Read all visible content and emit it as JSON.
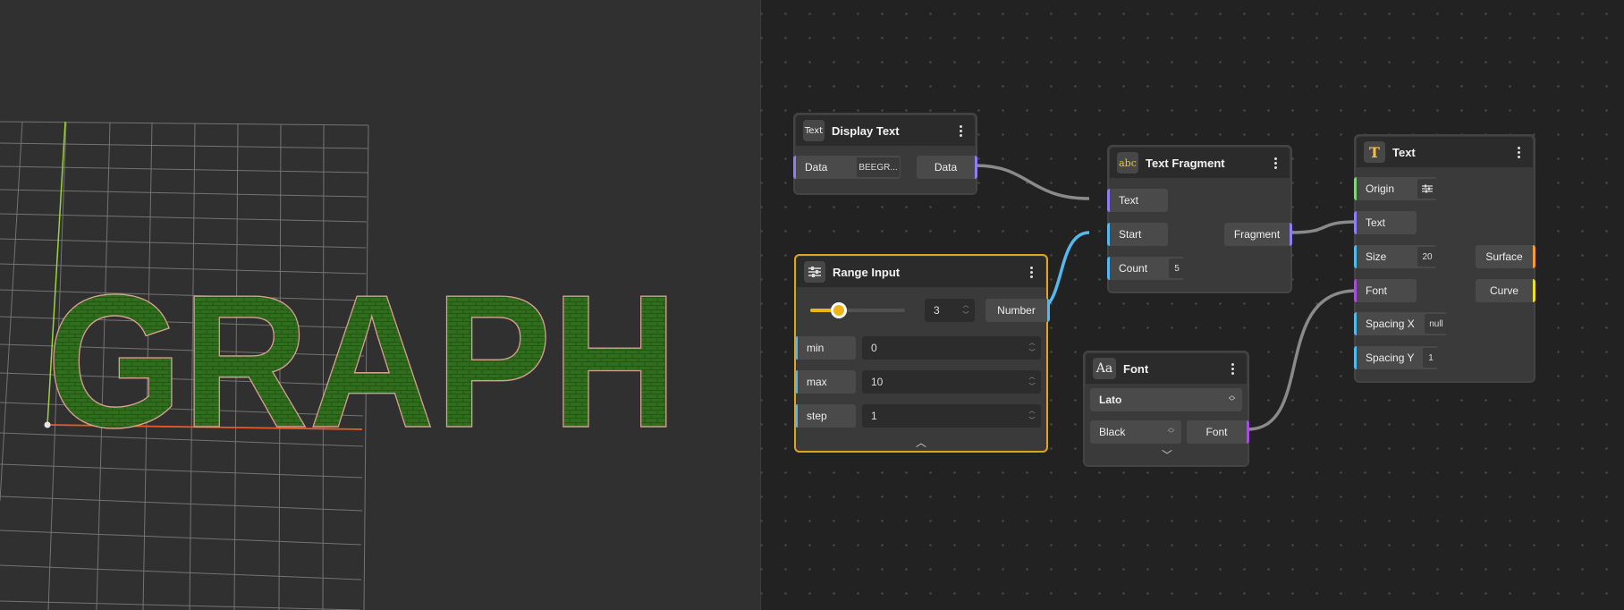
{
  "viewport": {
    "rendered_text": "GRAPH",
    "text_color": "#2f6e1c",
    "outline_color": "#d8a090"
  },
  "graph": {
    "display_text": {
      "title": "Display Text",
      "icon_label": "Text",
      "input_label": "Data",
      "input_value": "BEEGR...",
      "output_label": "Data"
    },
    "range_input": {
      "title": "Range Input",
      "value": "3",
      "slider_fraction": 0.3,
      "output_label": "Number",
      "fields": [
        {
          "label": "min",
          "value": "0"
        },
        {
          "label": "max",
          "value": "10"
        },
        {
          "label": "step",
          "value": "1"
        }
      ]
    },
    "text_fragment": {
      "title": "Text Fragment",
      "inputs": [
        {
          "label": "Text"
        },
        {
          "label": "Start"
        },
        {
          "label": "Count",
          "value": "5"
        }
      ],
      "output_label": "Fragment"
    },
    "font": {
      "title": "Font",
      "icon_label": "Aa",
      "family": "Lato",
      "weight": "Black",
      "output_label": "Font"
    },
    "text": {
      "title": "Text",
      "inputs": [
        {
          "label": "Origin"
        },
        {
          "label": "Text"
        },
        {
          "label": "Size",
          "value": "20"
        },
        {
          "label": "Font"
        },
        {
          "label": "Spacing X",
          "value": "null"
        },
        {
          "label": "Spacing Y",
          "value": "1"
        }
      ],
      "outputs": [
        {
          "label": "Surface"
        },
        {
          "label": "Curve"
        }
      ]
    }
  }
}
